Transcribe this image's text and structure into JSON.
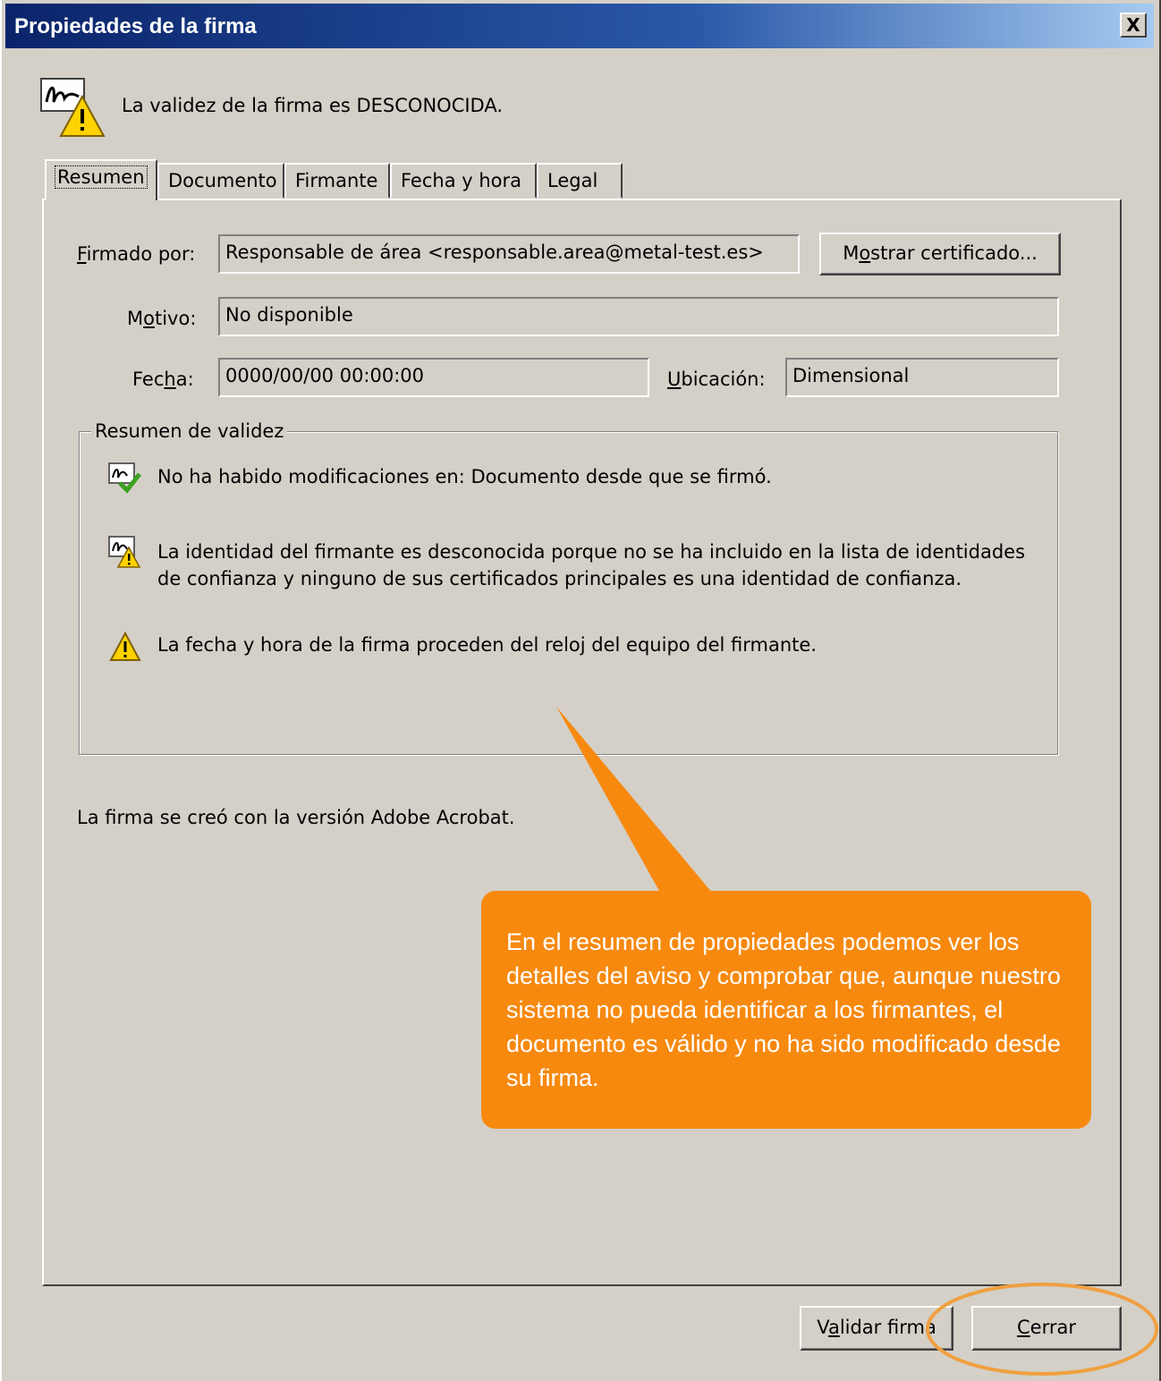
{
  "window": {
    "title": "Propiedades de la firma",
    "close_label": "X"
  },
  "status": {
    "message": "La validez de la firma es DESCONOCIDA."
  },
  "tabs": [
    {
      "label": "Resumen",
      "active": true
    },
    {
      "label": "Documento",
      "active": false
    },
    {
      "label": "Firmante",
      "active": false
    },
    {
      "label": "Fecha y hora",
      "active": false
    },
    {
      "label": "Legal",
      "active": false
    }
  ],
  "summary": {
    "signed_by": {
      "accel": "F",
      "label_rest": "irmado por:",
      "value": "Responsable de área <responsable.area@metal-test.es>"
    },
    "show_cert": {
      "pre": "M",
      "accel": "o",
      "post": "strar certificado..."
    },
    "reason": {
      "pre": "M",
      "accel": "o",
      "post": "tivo:",
      "value": "No disponible"
    },
    "date": {
      "pre": "Fec",
      "accel": "h",
      "post": "a:",
      "value": "0000/00/00  00:00:00"
    },
    "location": {
      "accel": "U",
      "post": "bicación:",
      "value": "Dimensional"
    }
  },
  "validity": {
    "legend": "Resumen de validez",
    "items": [
      {
        "icon": "signature-valid-icon",
        "text": "No ha habido modificaciones en: Documento desde que se firmó."
      },
      {
        "icon": "signature-unknown-icon",
        "text": "La identidad del firmante es desconocida porque no se ha incluido en la lista de identidades de confianza y ninguno de sus certificados principales es una identidad de confianza."
      },
      {
        "icon": "warning-icon",
        "text": "La fecha y hora de la firma proceden del reloj del equipo del firmante."
      }
    ]
  },
  "created_with": "La firma se creó con la versión Adobe Acrobat.",
  "buttons": {
    "validate": {
      "pre": "V",
      "accel": "a",
      "post": "lidar firma"
    },
    "close": {
      "accel": "C",
      "post": "errar"
    }
  },
  "callout": {
    "text": "En el resumen de propiedades podemos ver los detalles del aviso y comprobar que, aunque nuestro sistema no pueda identificar a los firmantes, el documento es válido y no ha sido modificado desde su firma.",
    "color": "#f7890f"
  },
  "highlight_color": "#f0a040"
}
